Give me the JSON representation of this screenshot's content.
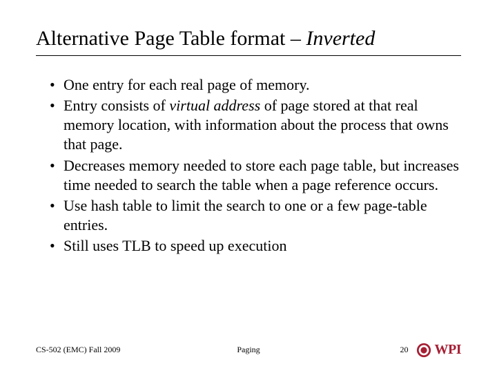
{
  "title_prefix": "Alternative Page Table format – ",
  "title_em": "Inverted",
  "bullets": [
    {
      "pre": "One entry for each real page of memory.",
      "em": "",
      "post": ""
    },
    {
      "pre": "Entry consists of ",
      "em": "virtual address",
      "post": " of page stored at that real memory location, with information about the process that owns that page."
    },
    {
      "pre": "Decreases memory needed to store each page table, but increases time needed to search the table when a page reference occurs.",
      "em": "",
      "post": ""
    },
    {
      "pre": "Use hash table to limit the search to one or a few page-table entries.",
      "em": "",
      "post": ""
    },
    {
      "pre": "Still uses TLB to speed up execution",
      "em": "",
      "post": ""
    }
  ],
  "footer": {
    "left": "CS-502 (EMC) Fall 2009",
    "center": "Paging",
    "page": "20",
    "logo_text": "WPI"
  }
}
